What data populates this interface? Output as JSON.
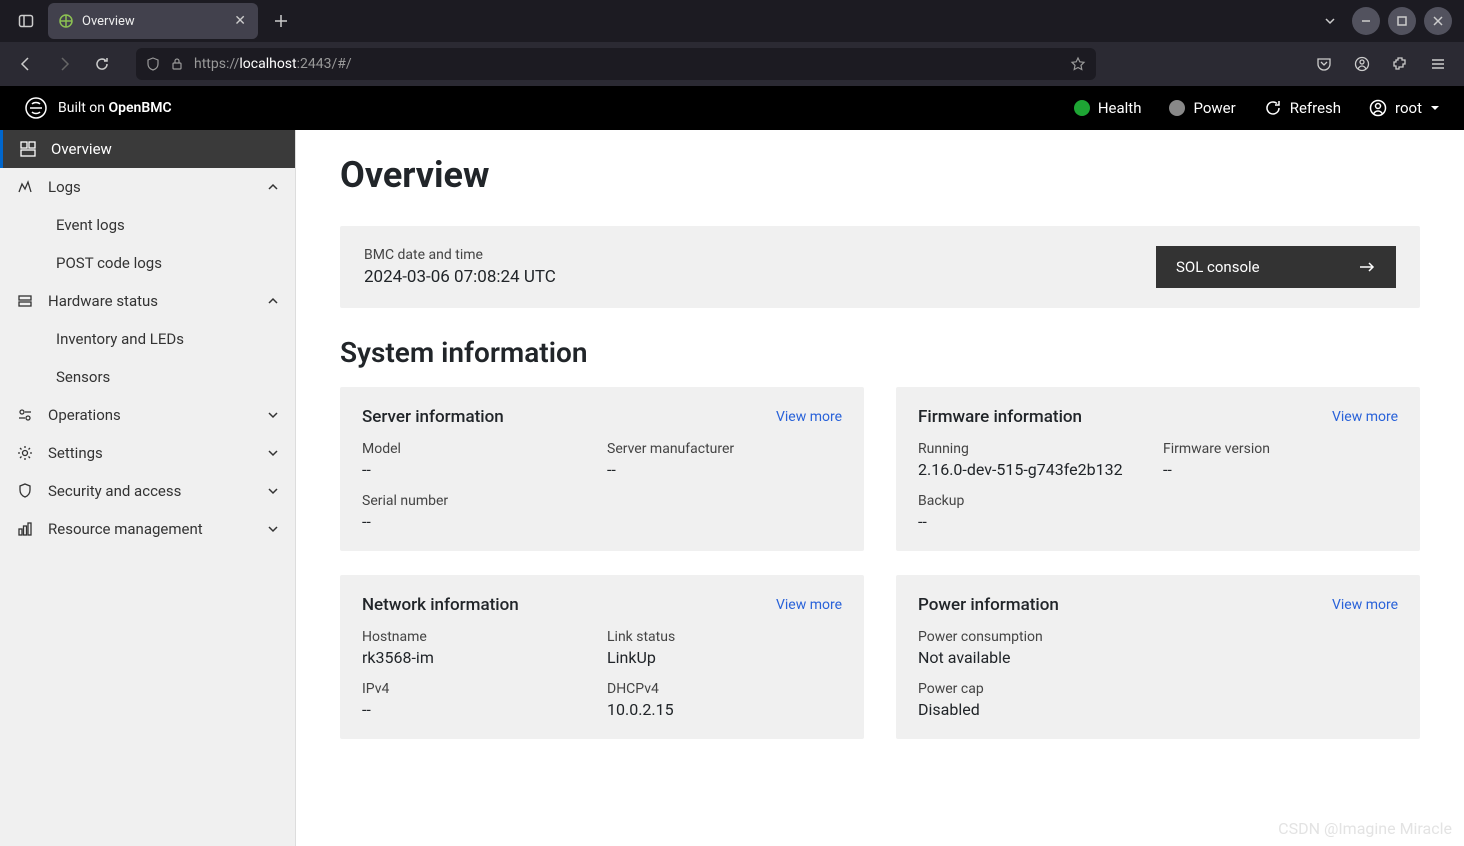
{
  "browser": {
    "tab_title": "Overview",
    "url_prefix": "https://",
    "url_host": "localhost",
    "url_suffix": ":2443/#/"
  },
  "header": {
    "brand_prefix": "Built on ",
    "brand_name": "OpenBMC",
    "health": "Health",
    "power": "Power",
    "refresh": "Refresh",
    "user": "root"
  },
  "sidebar": {
    "overview": "Overview",
    "logs": "Logs",
    "event_logs": "Event logs",
    "post_code_logs": "POST code logs",
    "hardware_status": "Hardware status",
    "inventory_leds": "Inventory and LEDs",
    "sensors": "Sensors",
    "operations": "Operations",
    "settings": "Settings",
    "security_access": "Security and access",
    "resource_mgmt": "Resource management"
  },
  "page": {
    "title": "Overview",
    "bmc_label": "BMC date and time",
    "bmc_value": "2024-03-06 07:08:24 UTC",
    "sol_button": "SOL console",
    "system_info": "System information",
    "view_more": "View more",
    "server_card": {
      "title": "Server information",
      "model_label": "Model",
      "model_value": "--",
      "mfr_label": "Server manufacturer",
      "mfr_value": "--",
      "serial_label": "Serial number",
      "serial_value": "--"
    },
    "firmware_card": {
      "title": "Firmware information",
      "running_label": "Running",
      "running_value": "2.16.0-dev-515-g743fe2b132",
      "version_label": "Firmware version",
      "version_value": "--",
      "backup_label": "Backup",
      "backup_value": "--"
    },
    "network_card": {
      "title": "Network information",
      "hostname_label": "Hostname",
      "hostname_value": "rk3568-im",
      "linkstatus_label": "Link status",
      "linkstatus_value": "LinkUp",
      "ipv4_label": "IPv4",
      "ipv4_value": "--",
      "dhcp_label": "DHCPv4",
      "dhcp_value": "10.0.2.15"
    },
    "power_card": {
      "title": "Power information",
      "consumption_label": "Power consumption",
      "consumption_value": "Not available",
      "cap_label": "Power cap",
      "cap_value": "Disabled"
    }
  },
  "watermark": "CSDN @Imagine Miracle"
}
